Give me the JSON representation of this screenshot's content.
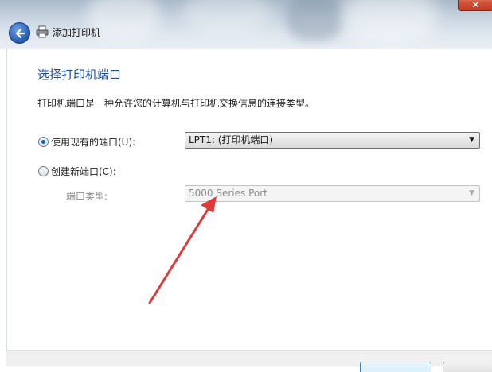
{
  "window": {
    "title": "添加打印机",
    "close_glyph": "✕"
  },
  "page": {
    "heading": "选择打印机端口",
    "description": "打印机端口是一种允许您的计算机与打印机交换信息的连接类型。"
  },
  "options": {
    "use_existing": {
      "label": "使用现有的端口(U):",
      "selected": true,
      "value": "LPT1: (打印机端口)"
    },
    "create_new": {
      "label": "创建新端口(C):",
      "selected": false,
      "port_type_label": "端口类型:",
      "port_type_value": "5000 Series Port"
    }
  },
  "colors": {
    "heading": "#1d4a8c",
    "annotation_arrow": "#e03a3a"
  },
  "icons": {
    "back": "back-arrow-icon",
    "printer": "printer-icon",
    "dropdown": "chevron-down-icon",
    "close": "close-icon"
  }
}
